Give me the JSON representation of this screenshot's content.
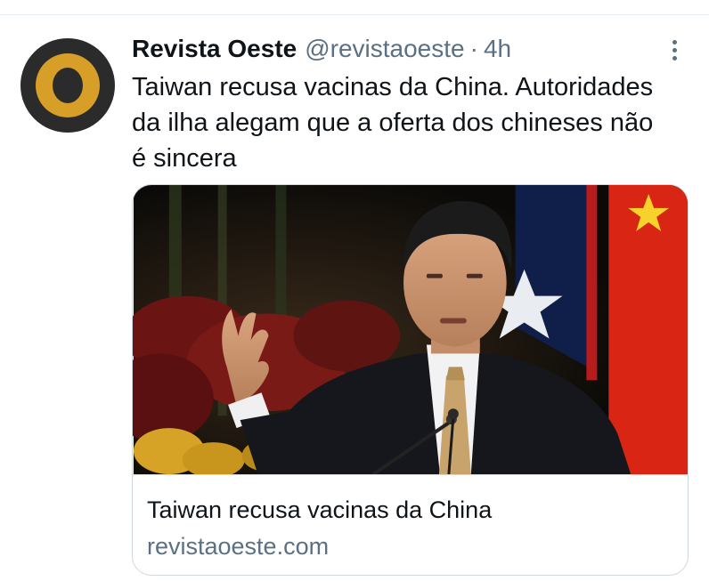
{
  "tweet": {
    "author": {
      "display_name": "Revista Oeste",
      "handle": "@revistaoeste",
      "avatar_icon": "revista-oeste-logo"
    },
    "separator": "·",
    "time": "4h",
    "text": "Taiwan recusa vacinas da China. Autoridades\nda ilha alegam que a oferta dos chineses não\né sincera",
    "more_icon": "more-vertical-icon",
    "card": {
      "title": "Taiwan recusa vacinas da China",
      "domain": "revistaoeste.com"
    }
  },
  "colors": {
    "text_primary": "#0f1419",
    "text_secondary": "#5b7083",
    "border": "#cfd9de",
    "logo_gold": "#d79f27",
    "logo_dark": "#2b2b2b",
    "flag_red": "#d92514",
    "flag_yellow": "#f6d22b"
  }
}
